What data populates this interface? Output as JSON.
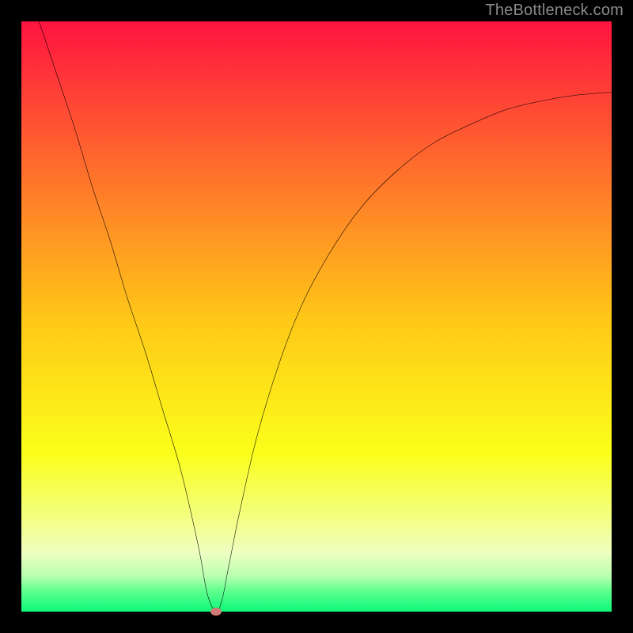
{
  "watermark": "TheBottleneck.com",
  "chart_data": {
    "type": "line",
    "title": "",
    "xlabel": "",
    "ylabel": "",
    "xlim": [
      0,
      100
    ],
    "ylim": [
      0,
      100
    ],
    "series": [
      {
        "name": "curve",
        "x": [
          3,
          6,
          9,
          12,
          15,
          18,
          21,
          24,
          27,
          30,
          31.5,
          33,
          34,
          35,
          37,
          40,
          44,
          48,
          53,
          58,
          64,
          70,
          76,
          82,
          88,
          94,
          100
        ],
        "y": [
          100,
          91,
          82,
          72,
          63,
          53,
          44,
          34,
          24,
          11,
          3,
          0,
          2,
          7,
          17,
          30,
          43,
          53,
          62,
          69,
          75,
          79.5,
          82.5,
          85,
          86.5,
          87.5,
          88
        ]
      }
    ],
    "marker": {
      "x": 33,
      "y": 0
    },
    "gradient_stops": [
      {
        "offset": 0.0,
        "color": "#ff1340"
      },
      {
        "offset": 0.25,
        "color": "#ff6e2c"
      },
      {
        "offset": 0.5,
        "color": "#ffc617"
      },
      {
        "offset": 0.73,
        "color": "#fbff1a"
      },
      {
        "offset": 0.84,
        "color": "#f3ff80"
      },
      {
        "offset": 0.9,
        "color": "#efffc1"
      },
      {
        "offset": 0.94,
        "color": "#b8ffb0"
      },
      {
        "offset": 0.965,
        "color": "#5fff8e"
      },
      {
        "offset": 1.0,
        "color": "#0cf77a"
      }
    ]
  }
}
